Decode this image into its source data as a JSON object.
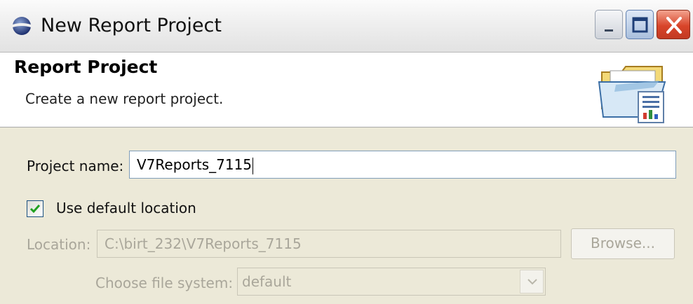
{
  "window": {
    "title": "New Report Project",
    "controls": {
      "minimize_icon": "minimize-icon",
      "maximize_icon": "maximize-icon",
      "close_icon": "close-icon"
    }
  },
  "banner": {
    "title": "Report Project",
    "description": "Create a new report project.",
    "icon": "report-project-wizard-icon"
  },
  "form": {
    "project_name_label": "Project name:",
    "project_name_value": "V7Reports_7115",
    "use_default_location_label": "Use default location",
    "use_default_location_checked": true,
    "location_label": "Location:",
    "location_value": "C:\\birt_232\\V7Reports_7115",
    "browse_label": "Browse...",
    "file_system_label": "Choose file system:",
    "file_system_value": "default"
  },
  "colors": {
    "accent_check": "#21a121",
    "close_button": "#d8452a",
    "disabled_text": "#a9a69a"
  }
}
